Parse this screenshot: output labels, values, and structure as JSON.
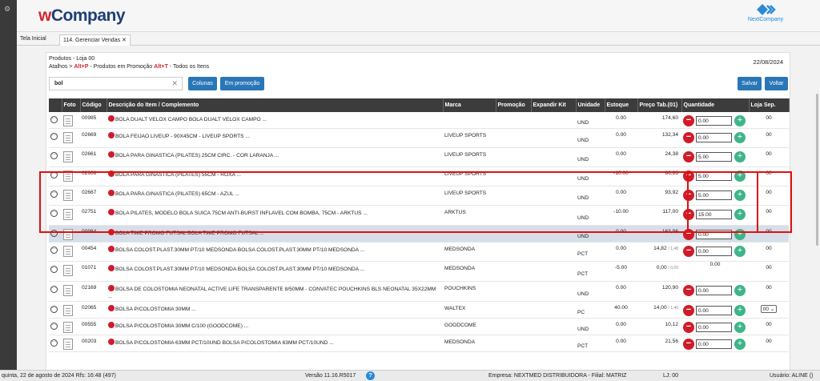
{
  "app": {
    "logo_w": "w",
    "logo_rest": "Company",
    "partner_logo": "NextCompany",
    "leftbar_icon": "gear-icon"
  },
  "tabs": [
    {
      "label": "Tela Inicial"
    },
    {
      "label": "114. Gerenciar Vendas",
      "close": "✕"
    }
  ],
  "panel": {
    "title": "Produtos - Loja 00",
    "shortcuts_prefix": "Atalhos >",
    "alt_p": "Alt+P",
    "alt_p_label": "- Produtos em Promoção",
    "alt_t": "Alt+T",
    "alt_t_label": "- Todos os Itens",
    "date": "22/08/2024"
  },
  "search": {
    "value": "bol",
    "clear": "✕"
  },
  "buttons": {
    "columns": "Colunas",
    "promo": "Em promoção",
    "save": "Salvar",
    "back": "Voltar"
  },
  "columns": [
    "",
    "Foto",
    "Código",
    "Descrição do Item / Complemento",
    "Marca",
    "Promoção",
    "Expandir Kit",
    "Unidade",
    "Estoque",
    "Preço Tab.(01)",
    "Quantidade",
    "Loja Sep."
  ],
  "rows": [
    {
      "code": "00985",
      "desc": "BOLA DUALT VELOX CAMPO BOLA DUALT VELOX CAMPO ...",
      "brand": "",
      "unit": "UND",
      "stock": "0.00",
      "price": "174,60",
      "qty": "0.00",
      "loja": "00"
    },
    {
      "code": "02669",
      "desc": "BOLA FEIJAO LIVEUP - 90X45CM - LIVEUP SPORTS ...",
      "brand": "LIVEUP SPORTS",
      "unit": "UND",
      "stock": "0.00",
      "price": "132,34",
      "qty": "0.00",
      "loja": "00"
    },
    {
      "code": "02661",
      "desc": "BOLA PARA GINASTICA (PILATES) 25CM CIRC. - COR LARANJA ...",
      "brand": "LIVEUP SPORTS",
      "unit": "UND",
      "stock": "0.00",
      "price": "24,38",
      "qty": "5.00",
      "loja": "00"
    },
    {
      "code": "02668",
      "desc": "BOLA PARA GINASTICA (PILATES) 55CM - ROXA ...",
      "brand": "LIVEUP SPORTS",
      "unit": "UND",
      "stock": "-10.00",
      "price": "86,86",
      "qty": "5.00",
      "loja": "00"
    },
    {
      "code": "02667",
      "desc": "BOLA PARA GINASTICA (PILATES) 65CM - AZUL ...",
      "brand": "LIVEUP SPORTS",
      "unit": "UND",
      "stock": "0.00",
      "price": "93,92",
      "qty": "5.00",
      "loja": "00"
    },
    {
      "code": "02751",
      "desc": "BOLA PILATES, MODELO BOLA SUICA 75CM ANTI-BURST INFLAVEL COM BOMBA, 75CM - ARKTUS ...",
      "brand": "ARKTUS",
      "unit": "UND",
      "stock": "-10.00",
      "price": "117,00",
      "qty": "15.00",
      "loja": "00"
    },
    {
      "code": "00984",
      "desc": "BOLA TIME PROMO FUTSAL BOLA TIME PROMO FUTSAL ...",
      "brand": "",
      "unit": "UND",
      "stock": "0.00",
      "price": "163,96",
      "qty": "0.00",
      "loja": "00"
    },
    {
      "code": "00454",
      "desc": "BOLSA COLOST.PLAST.30MM PT/10 MEDSONDA BOLSA COLOST.PLAST.30MM PT/10 MEDSONDA ...",
      "brand": "MEDSONDA",
      "unit": "PCT",
      "stock": "0.00",
      "price": "14,82",
      "price_small": "/ 1,48",
      "qty": "0.00",
      "loja": "00"
    },
    {
      "code": "01071",
      "desc": "BOLSA COLOST.PLAST.30MM PT/10 MEDSONDA BOLSA COLOST.PLAST.30MM PT/10 MEDSONDA ...",
      "brand": "MEDSONDA",
      "unit": "PCT",
      "stock": "-5.00",
      "price": "0,00",
      "price_small": "/ 0,00",
      "qty_text": "0.00",
      "loja": "00"
    },
    {
      "code": "02169",
      "desc": "BOLSA DE COLOSTOMIA NEONATAL ACTIVE LIFE TRANSPARENTE 8/50MM - CONVATEC POUCHKINS BLS NEONATAL 35X22MM ...",
      "brand": "POUCHKINS",
      "unit": "UND",
      "stock": "0.00",
      "price": "120,90",
      "qty": "0.00",
      "loja": "00"
    },
    {
      "code": "02065",
      "desc": "BOLSA P/COLOSTOMIA 30MM ...",
      "brand": "WALTEX",
      "unit": "PC",
      "stock": "40.00",
      "price": "14,00",
      "price_small": "/ 1,40",
      "qty": "0.00",
      "loja_select": "00 ⌄"
    },
    {
      "code": "00555",
      "desc": "BOLSA P/COLOSTOMIA 30MM C/100 (GOODCOME) ...",
      "brand": "GOODCOME",
      "unit": "UND",
      "stock": "0.00",
      "price": "10,12",
      "qty": "0.00",
      "loja": "00"
    },
    {
      "code": "00203",
      "desc": "BOLSA P/COLOSTOMIA 63MM PCT/10UND BOLSA P/COLOSTOMIA 63MM PCT/10UND ...",
      "brand": "MEDSONDA",
      "unit": "PCT",
      "stock": "0.00",
      "price": "21,56",
      "qty": "0.00",
      "loja": "00"
    }
  ],
  "status": {
    "datetime": "quinta, 22 de agosto de 2024  Rfs: 16:48 (497)",
    "version": "Versão 11.16.R5017",
    "help": "?",
    "company": "Empresa: NEXTMED DISTRIBUIDORA - Filial: MATRIZ",
    "lj": "LJ: 00",
    "user": "Usuário: ALINE ()"
  },
  "colors": {
    "accent": "#2a76b8",
    "header_dark": "#3c3c3c",
    "minus": "#d01c2a",
    "plus": "#3eb489",
    "highlight": "#e01010"
  }
}
